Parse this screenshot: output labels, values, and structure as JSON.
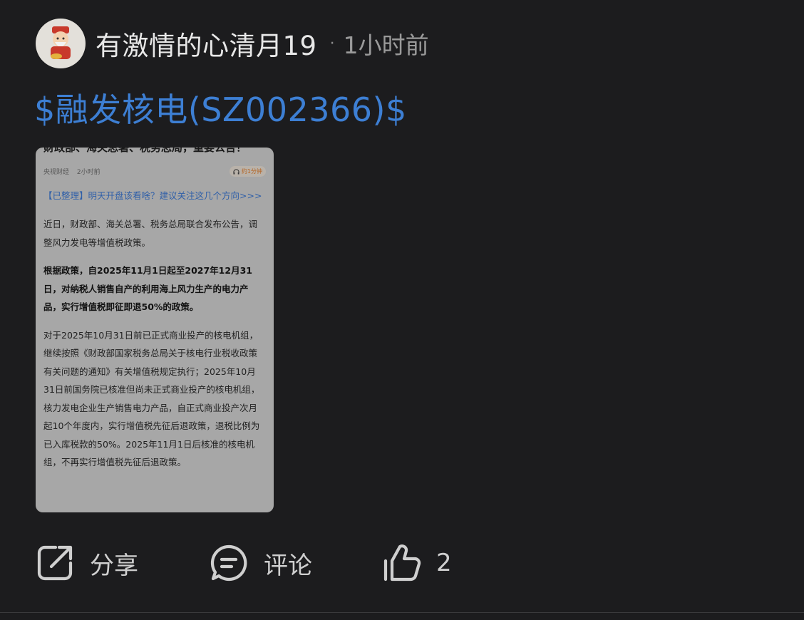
{
  "post": {
    "username": "有激情的心清月19",
    "separator": "·",
    "time": "1小时前",
    "stock_tag": "$融发核电(SZ002366)$"
  },
  "article": {
    "title": "财政部、海关总署、税务总局，重要公告！",
    "source": "央视财经",
    "time": "2小时前",
    "listen_label": "约1分钟",
    "link": "【已整理】明天开盘该看啥？建议关注这几个方向>>>",
    "p1": "近日，财政部、海关总署、税务总局联合发布公告，调整风力发电等增值税政策。",
    "p2": "根据政策，自2025年11月1日起至2027年12月31日，对纳税人销售自产的利用海上风力生产的电力产品，实行增值税即征即退50%的政策。",
    "p3": "对于2025年10月31日前已正式商业投产的核电机组，继续按照《财政部国家税务总局关于核电行业税收政策有关问题的通知》有关增值税规定执行；2025年10月31日前国务院已核准但尚未正式商业投产的核电机组，核力发电企业生产销售电力产品，自正式商业投产次月起10个年度内，实行增值税先征后退政策，退税比例为已入库税款的50%。2025年11月1日后核准的核电机组，不再实行增值税先征后退政策。"
  },
  "actions": {
    "share_label": "分享",
    "comment_label": "评论",
    "like_count": "2"
  },
  "colors": {
    "background": "#1c1c1e",
    "link_blue": "#3d7fd4",
    "card_bg": "#a7a7a7"
  },
  "icons": {
    "avatar": "avatar-illustration",
    "share": "share-icon",
    "comment": "comment-icon",
    "like": "thumbs-up-icon",
    "listen": "headphones-icon"
  }
}
